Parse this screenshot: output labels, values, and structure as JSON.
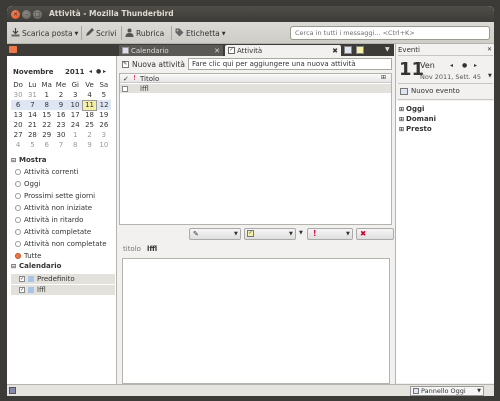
{
  "window": {
    "title": "Attività - Mozilla Thunderbird"
  },
  "toolbar": {
    "get_mail": "Scarica posta",
    "write": "Scrivi",
    "address_book": "Rubrica",
    "tag": "Etichetta",
    "search_placeholder": "Cerca in tutti i messaggi... <Ctrl+K>"
  },
  "tabs": [
    {
      "label": "Calendario"
    },
    {
      "label": "Attività"
    }
  ],
  "calendar": {
    "month": "Novembre",
    "year": "2011",
    "weekdays": [
      "Do",
      "Lu",
      "Ma",
      "Me",
      "Gi",
      "Ve",
      "Sa"
    ],
    "weeks": [
      [
        "30",
        "31",
        "1",
        "2",
        "3",
        "4",
        "5"
      ],
      [
        "6",
        "7",
        "8",
        "9",
        "10",
        "11",
        "12"
      ],
      [
        "13",
        "14",
        "15",
        "16",
        "17",
        "18",
        "19"
      ],
      [
        "20",
        "21",
        "22",
        "23",
        "24",
        "25",
        "26"
      ],
      [
        "27",
        "28",
        "29",
        "30",
        "1",
        "2",
        "3"
      ],
      [
        "4",
        "5",
        "6",
        "7",
        "8",
        "9",
        "10"
      ]
    ],
    "today": "11"
  },
  "filters": {
    "heading": "Mostra",
    "options": [
      "Attività correnti",
      "Oggi",
      "Prossimi sette giorni",
      "Attività non iniziate",
      "Attività in ritardo",
      "Attività completate",
      "Attività non completate",
      "Tutte"
    ],
    "selected": "Tutte"
  },
  "calendars": {
    "heading": "Calendario",
    "items": [
      "Predefinito",
      "lffl"
    ]
  },
  "tasks": {
    "new_task_button": "Nuova attività",
    "new_task_placeholder": "Fare clic qui per aggiungere una nuova attività",
    "column_title": "Titolo",
    "rows": [
      "lffl"
    ]
  },
  "task_detail": {
    "title_label": "titolo",
    "title_value": "lffl"
  },
  "today_pane": {
    "header": "Eventi",
    "day_number": "11",
    "day_name": "Ven",
    "month_info": "Nov 2011, Sett. 45",
    "new_event": "Nuovo evento",
    "groups": [
      "Oggi",
      "Domani",
      "Presto"
    ],
    "pane_button": "Pannello Oggi"
  },
  "colors": {
    "accent": "#f07746",
    "calendar_color": "#a8c4e6"
  }
}
